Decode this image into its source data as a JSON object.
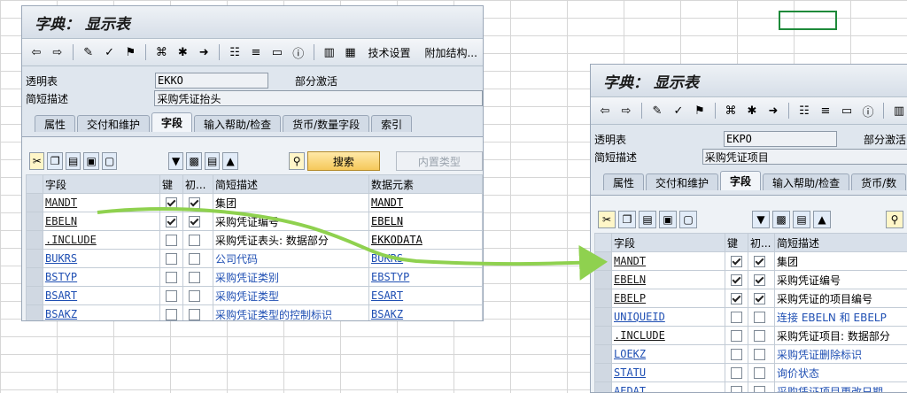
{
  "window_left": {
    "title": "字典： 显示表",
    "toolbar": {
      "tech_settings": "技术设置",
      "append_struct": "附加结构..."
    },
    "fields": {
      "table_label": "透明表",
      "table_value": "EKKO",
      "status": "部分激活",
      "desc_label": "简短描述",
      "desc_value": "采购凭证抬头"
    },
    "tabs": [
      "属性",
      "交付和维护",
      "字段",
      "输入帮助/检查",
      "货币/数量字段",
      "索引"
    ],
    "buttons": {
      "search": "搜索",
      "builtin_type": "内置类型"
    },
    "columns": [
      "字段",
      "键",
      "初...",
      "简短描述",
      "数据元素"
    ],
    "rows": [
      {
        "field": "MANDT",
        "key": true,
        "init": true,
        "desc": "集团",
        "de": "MANDT"
      },
      {
        "field": "EBELN",
        "key": true,
        "init": true,
        "desc": "采购凭证编号",
        "de": "EBELN"
      },
      {
        "field": ".INCLUDE",
        "key": false,
        "init": false,
        "desc": "采购凭证表头: 数据部分",
        "de": "EKKODATA"
      },
      {
        "field": "BUKRS",
        "key": false,
        "init": false,
        "desc": "公司代码",
        "de": "BUKRS"
      },
      {
        "field": "BSTYP",
        "key": false,
        "init": false,
        "desc": "采购凭证类别",
        "de": "EBSTYP"
      },
      {
        "field": "BSART",
        "key": false,
        "init": false,
        "desc": "采购凭证类型",
        "de": "ESART"
      },
      {
        "field": "BSAKZ",
        "key": false,
        "init": false,
        "desc": "采购凭证类型的控制标识",
        "de": "BSAKZ"
      }
    ]
  },
  "window_right": {
    "title": "字典： 显示表",
    "fields": {
      "table_label": "透明表",
      "table_value": "EKPO",
      "status": "部分激活",
      "desc_label": "简短描述",
      "desc_value": "采购凭证项目"
    },
    "tabs": [
      "属性",
      "交付和维护",
      "字段",
      "输入帮助/检查",
      "货币/数"
    ],
    "columns": [
      "字段",
      "键",
      "初...",
      "简短描述"
    ],
    "rows": [
      {
        "field": "MANDT",
        "key": true,
        "init": true,
        "desc": "集团"
      },
      {
        "field": "EBELN",
        "key": true,
        "init": true,
        "desc": "采购凭证编号"
      },
      {
        "field": "EBELP",
        "key": true,
        "init": true,
        "desc": "采购凭证的项目编号"
      },
      {
        "field": "UNIQUEID",
        "key": false,
        "init": false,
        "desc": "连接 EBELN 和 EBELP"
      },
      {
        "field": ".INCLUDE",
        "key": false,
        "init": false,
        "desc": "采购凭证项目: 数据部分"
      },
      {
        "field": "LOEKZ",
        "key": false,
        "init": false,
        "desc": "采购凭证删除标识"
      },
      {
        "field": "STATU",
        "key": false,
        "init": false,
        "desc": "询价状态"
      },
      {
        "field": "AEDAT",
        "key": false,
        "init": false,
        "desc": "采购凭证项目更改日期"
      }
    ]
  },
  "colors": {
    "arrow": "#8fd14f",
    "selected_cell": "#1e8a3a",
    "link": "#1f4fb3"
  }
}
